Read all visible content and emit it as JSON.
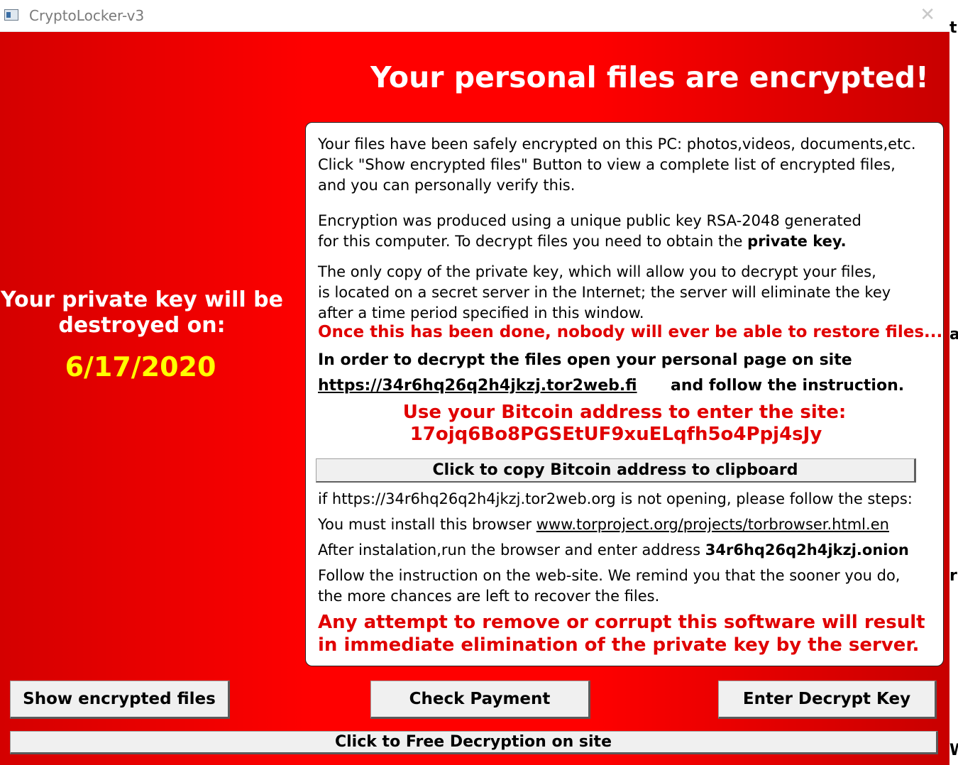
{
  "window": {
    "title": "CryptoLocker-v3",
    "close_glyph": "✕",
    "icon": "app-window-icon"
  },
  "background_strip": {
    "letters": [
      "t",
      "a",
      "r",
      "W"
    ]
  },
  "header": {
    "headline": "Your personal files are encrypted!"
  },
  "left": {
    "line1": "Your private key will be",
    "line2": "destroyed on:",
    "date": "6/17/2020"
  },
  "panel": {
    "para1": [
      "Your files have been safely encrypted on this PC: photos,videos, documents,etc.",
      "Click \"Show encrypted files\" Button to view a complete list of encrypted files,",
      "and you can personally verify this."
    ],
    "para2_line1": "Encryption was produced using a unique public key RSA-2048 generated",
    "para2_line2": "for this computer. To decrypt files you need to obtain the",
    "para2_bold": "private key.",
    "para3": [
      "The only copy of the private key, which will allow you to decrypt your files,",
      "is located on a secret server in the Internet; the server will eliminate the key",
      "after a time period specified in this window."
    ],
    "warning1": "Once this has been done, nobody will ever be able to restore files...",
    "instr_line": "In order to decrypt the files open your personal page on site",
    "site_link": "https://34r6hq26q2h4jkzj.tor2web.fi",
    "instr_follow": "and follow the instruction.",
    "btc_line1": "Use your Bitcoin address to  enter the site:",
    "btc_address": "17ojq6Bo8PGSEtUF9xuELqfh5o4Ppj4sJy",
    "copy_button": "Click to copy Bitcoin address to clipboard",
    "steps_intro": "if https://34r6hq26q2h4jkzj.tor2web.org is not opening, please follow the steps:",
    "install_text": "You must install this browser",
    "tor_link": "www.torproject.org/projects/torbrowser.html.en",
    "after_install": "After instalation,run the browser and enter address",
    "onion": "34r6hq26q2h4jkzj.onion",
    "follow": [
      "Follow the instruction on the web-site. We remind you that the  sooner you do,",
      "the more chances are left to recover the files."
    ],
    "warning2": [
      "Any attempt to remove or corrupt this software will result",
      "in immediate elimination of the private key by the server."
    ]
  },
  "buttons": {
    "show_files": "Show encrypted files",
    "check_payment": "Check Payment",
    "enter_key": "Enter Decrypt Key",
    "free_decryption": "Click to Free Decryption on site"
  },
  "colors": {
    "background_red": "#ff0000",
    "date_yellow": "#ffff00",
    "warning_red": "#e00000"
  }
}
